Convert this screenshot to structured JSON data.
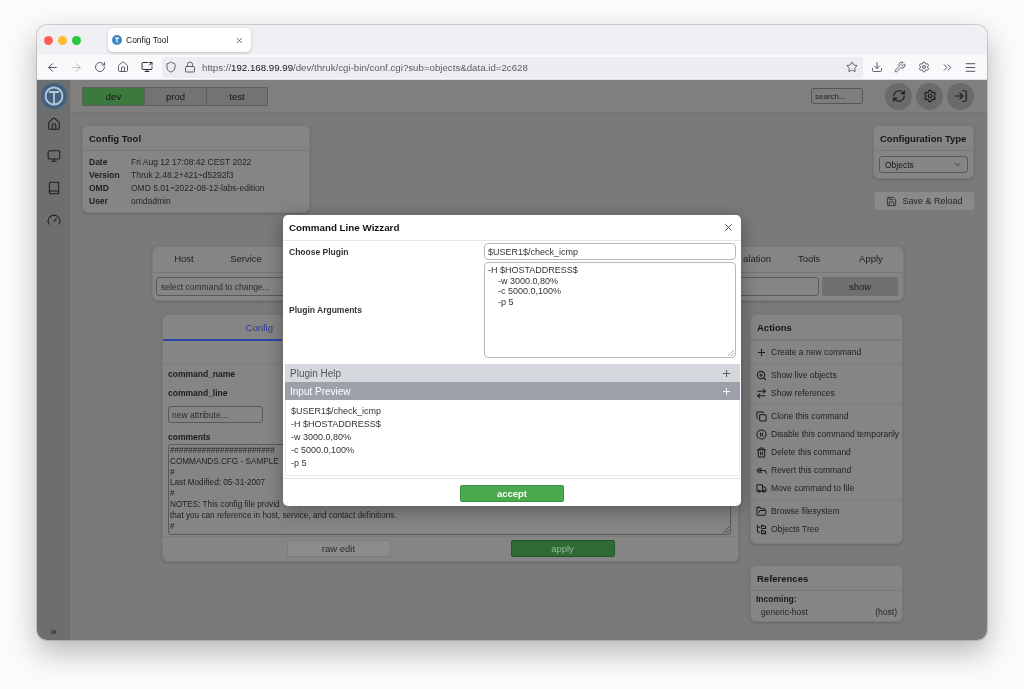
{
  "browser": {
    "tab": {
      "title": "Config Tool",
      "selected": true
    },
    "navigation": {
      "back": {
        "disabled": false
      },
      "forward": {
        "disabled": true
      }
    },
    "url": "https://**192.168.99.99**/dev/thruk/cgi-bin/conf.cgi?sub=objects&data.id=2c628"
  },
  "sidebar": {
    "toggle": "»"
  },
  "top_bar": {
    "environments": [
      {
        "label": "dev",
        "selected": true
      },
      {
        "label": "prod",
        "selected": false
      },
      {
        "label": "test",
        "selected": false
      }
    ],
    "search": {
      "placeholder": "search..."
    }
  },
  "info_card": {
    "title": "Config Tool",
    "rows": [
      {
        "label": "Date",
        "value": "Fri Aug 12 17:08:42 CEST 2022"
      },
      {
        "label": "Version",
        "value": "Thruk 2.48.2+421~d5292f3"
      },
      {
        "label": "OMD",
        "value": "OMD 5.01~2022-08-12-labs-edition"
      },
      {
        "label": "User",
        "value": "omdadmin"
      }
    ]
  },
  "config_type": {
    "title": "Configuration Type",
    "value": "Objects"
  },
  "save_button": {
    "label": "Save & Reload"
  },
  "object_tabs": {
    "tabs": [
      {
        "label": "Host",
        "selected": false
      },
      {
        "label": "Service",
        "selected": false
      },
      {
        "label": "alation",
        "selected": false
      },
      {
        "label": "Tools",
        "selected": false
      },
      {
        "label": "Apply",
        "selected": false
      }
    ],
    "select": {
      "placeholder": "select command to change..."
    },
    "show_button": "show"
  },
  "config_panel": {
    "tabs": [
      {
        "label": "Config",
        "selected": true
      }
    ],
    "attributes": [
      "command_name",
      "command_line"
    ],
    "new_attribute": {
      "placeholder": "new attribute..."
    },
    "comments": {
      "label": "comments",
      "lines": [
        "#######################",
        "COMMANDS.CFG - SAMPLE",
        "#",
        "Last Modified: 05-31-2007",
        "#",
        "NOTES: This config file provid",
        "that you can reference in host, service, and contact definitions.",
        "#"
      ]
    },
    "buttons": [
      {
        "kind": "secondary",
        "label": "raw edit"
      },
      {
        "kind": "primary",
        "label": "apply"
      }
    ]
  },
  "actions": {
    "title": "Actions",
    "groups": [
      [
        {
          "kind": "create",
          "label": "Create a new command"
        }
      ],
      [
        {
          "kind": "live",
          "label": "Show live objects"
        },
        {
          "kind": "references",
          "label": "Show references"
        }
      ],
      [
        {
          "kind": "clone",
          "label": "Clone this command"
        },
        {
          "kind": "disable",
          "label": "Disable this command temporarily"
        },
        {
          "kind": "delete",
          "label": "Delete this command"
        },
        {
          "kind": "revert",
          "label": "Revert this command"
        },
        {
          "kind": "move",
          "label": "Move command to file"
        }
      ],
      [
        {
          "kind": "browse",
          "label": "Browse filesystem"
        },
        {
          "kind": "tree",
          "label": "Objects Tree"
        }
      ]
    ]
  },
  "references": {
    "title": "References",
    "incoming": {
      "label": "Incoming:",
      "items": [
        {
          "name": "generic-host",
          "type": "(host)"
        }
      ]
    }
  },
  "wizard": {
    "title": "Command Line Wizzard",
    "plugin": {
      "label": "Choose Plugin",
      "value": "$USER1$/check_icmp"
    },
    "arguments": {
      "label": "Plugin Arguments",
      "value": "-H $HOSTADDRESS$\n    -w 3000.0,80%\n    -c 5000.0,100%\n    -p 5"
    },
    "sections": [
      {
        "label": "Plugin Help",
        "expanded": false
      },
      {
        "label": "Input Preview",
        "expanded": true,
        "lines": [
          "$USER1$/check_icmp",
          "-H $HOSTADDRESS$",
          "-w 3000.0,80%",
          "-c 5000.0,100%",
          "-p 5"
        ]
      }
    ],
    "accept_button": "accept"
  }
}
